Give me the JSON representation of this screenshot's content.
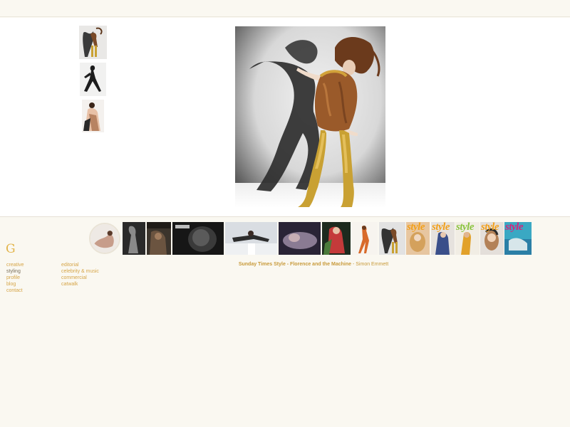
{
  "logo": {
    "text": "G"
  },
  "nav": {
    "primary": [
      {
        "label": "creative",
        "active": false
      },
      {
        "label": "styling",
        "active": true
      },
      {
        "label": "profile",
        "active": false
      },
      {
        "label": "blog",
        "active": false
      },
      {
        "label": "contact",
        "active": false
      }
    ],
    "secondary": [
      {
        "label": "editorial"
      },
      {
        "label": "celebrity & music"
      },
      {
        "label": "commercial"
      },
      {
        "label": "catwalk"
      }
    ]
  },
  "caption": {
    "title": "Sunday Times Style - Florence and the Machine",
    "separator": " - ",
    "credit": "Simon Emmett"
  },
  "magazines": [
    {
      "word": "style",
      "color": "#f2a01b"
    },
    {
      "word": "style",
      "color": "#f2a01b"
    },
    {
      "word": "style",
      "color": "#8bc43f"
    },
    {
      "word": "style",
      "color": "#f2a01b"
    },
    {
      "word": "style",
      "color": "#d8237a"
    }
  ],
  "colors": {
    "accent": "#d6a548",
    "active_nav": "#7a6f58",
    "background": "#faf8f1",
    "stage": "#ffffff"
  }
}
